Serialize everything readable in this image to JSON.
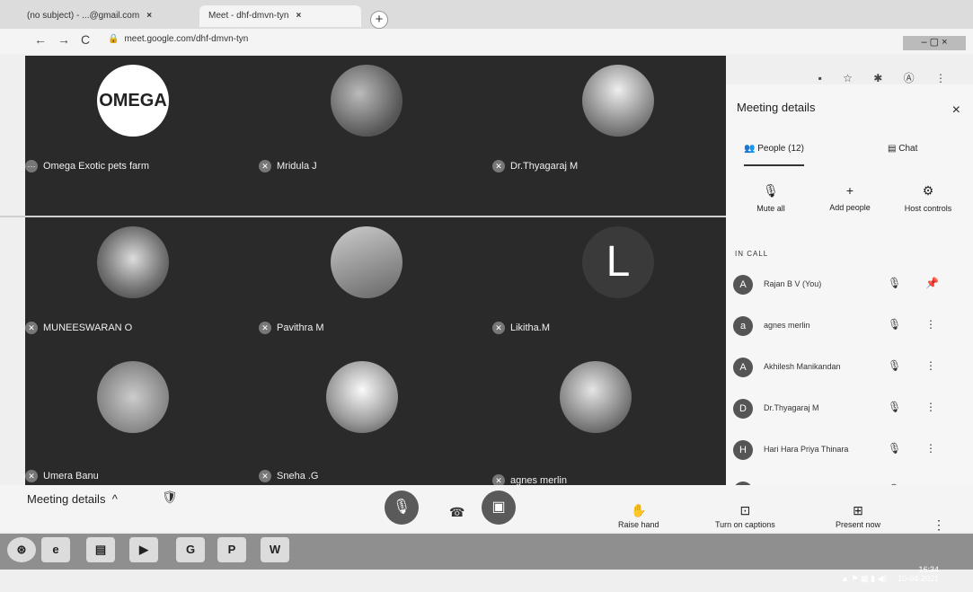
{
  "browser": {
    "tabs": [
      {
        "label": "(no subject) - ...@gmail.com",
        "close": "×"
      },
      {
        "label": "Meet - dhf-dmvn-tyn",
        "close": "×"
      }
    ],
    "new_tab": "+",
    "nav": {
      "back": "←",
      "forward": "→",
      "reload": "C"
    },
    "url": "meet.google.com/dhf-dmvn-tyn",
    "lock": "🔒",
    "toolbar_icons": "▪ ☆ ✱ Ⓐ ⋮",
    "window_controls": "– ▢ ×"
  },
  "tiles": [
    {
      "name": "Omega Exotic pets farm",
      "avatar": "OMEGA",
      "style": "omega"
    },
    {
      "name": "Mridula J",
      "avatar": "",
      "style": "photo1"
    },
    {
      "name": "Dr.Thyagaraj M",
      "avatar": "",
      "style": "photo2"
    },
    {
      "name": "MUNEESWARAN O",
      "avatar": "",
      "style": "photo3"
    },
    {
      "name": "Pavithra M",
      "avatar": "",
      "style": "photo4"
    },
    {
      "name": "Likitha.M",
      "avatar": "L",
      "style": "letter"
    },
    {
      "name": "Umera Banu",
      "avatar": "",
      "style": "photo6"
    },
    {
      "name": "Sneha .G",
      "avatar": "",
      "style": "photo5"
    },
    {
      "name": "agnes merlin",
      "avatar": "",
      "style": "photo7"
    }
  ],
  "panel": {
    "title": "Meeting details",
    "close": "×",
    "tabs": {
      "people": "People (12)",
      "chat": "Chat"
    },
    "actions": {
      "mute_all": "Mute all",
      "add_people": "Add people",
      "host_controls": "Host controls"
    },
    "in_call_label": "IN CALL",
    "people": [
      {
        "name": "Rajan B V (You)",
        "avatar": "A",
        "mic": "🎙",
        "more": "📌"
      },
      {
        "name": "agnes merlin",
        "avatar": "a",
        "mic": "🎙",
        "more": "⋮"
      },
      {
        "name": "Akhilesh Manikandan",
        "avatar": "A",
        "mic": "🎙",
        "more": "⋮"
      },
      {
        "name": "Dr.Thyagaraj M",
        "avatar": "D",
        "mic": "🎙",
        "more": "⋮"
      },
      {
        "name": "Hari Hara Priya Thinara",
        "avatar": "H",
        "mic": "🎙",
        "more": "⋮"
      },
      {
        "name": "",
        "avatar": "",
        "mic": "🎙",
        "more": "⋮"
      }
    ]
  },
  "bottom": {
    "meeting_details": "Meeting details",
    "chevron": "^",
    "shield": "🛡",
    "mic_icon": "🎙",
    "hangup_icon": "☎",
    "camera_icon": "▣",
    "raise_hand": "Raise hand",
    "raise_hand_icon": "✋",
    "captions": "Turn on captions",
    "captions_icon": "⊡",
    "present": "Present now",
    "present_icon": "⊞",
    "more": "⋮"
  },
  "taskbar": {
    "icons": [
      "⊛",
      "e",
      "▤",
      "▶",
      "G",
      "P",
      "W"
    ],
    "time": "16:34",
    "date": "10-04-2021"
  }
}
